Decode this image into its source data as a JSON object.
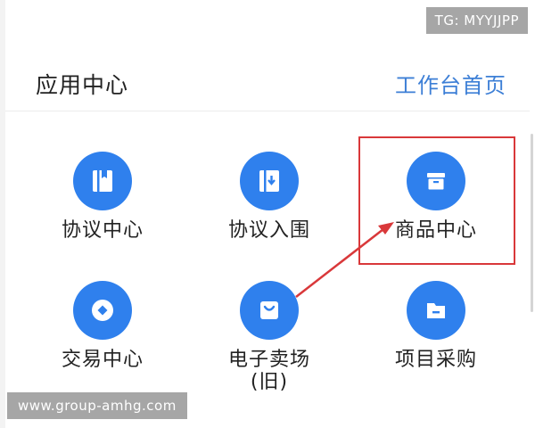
{
  "header": {
    "title": "应用中心",
    "link_label": "工作台首页"
  },
  "grid": {
    "items": [
      {
        "label": "协议中心",
        "icon": "book-icon"
      },
      {
        "label": "协议入围",
        "icon": "download-book-icon"
      },
      {
        "label": "商品中心",
        "icon": "archive-box-icon"
      },
      {
        "label": "交易中心",
        "icon": "diamond-coin-icon"
      },
      {
        "label": "电子卖场",
        "label2": "(旧)",
        "icon": "shopping-bag-icon"
      },
      {
        "label": "项目采购",
        "icon": "folder-icon"
      }
    ]
  },
  "watermarks": {
    "top": "TG: MYYJJPP",
    "bottom": "www.group-amhg.com"
  },
  "colors": {
    "icon_blue": "#2f80ed",
    "link_blue": "#3d7fd6",
    "highlight_red": "#d9383a"
  }
}
